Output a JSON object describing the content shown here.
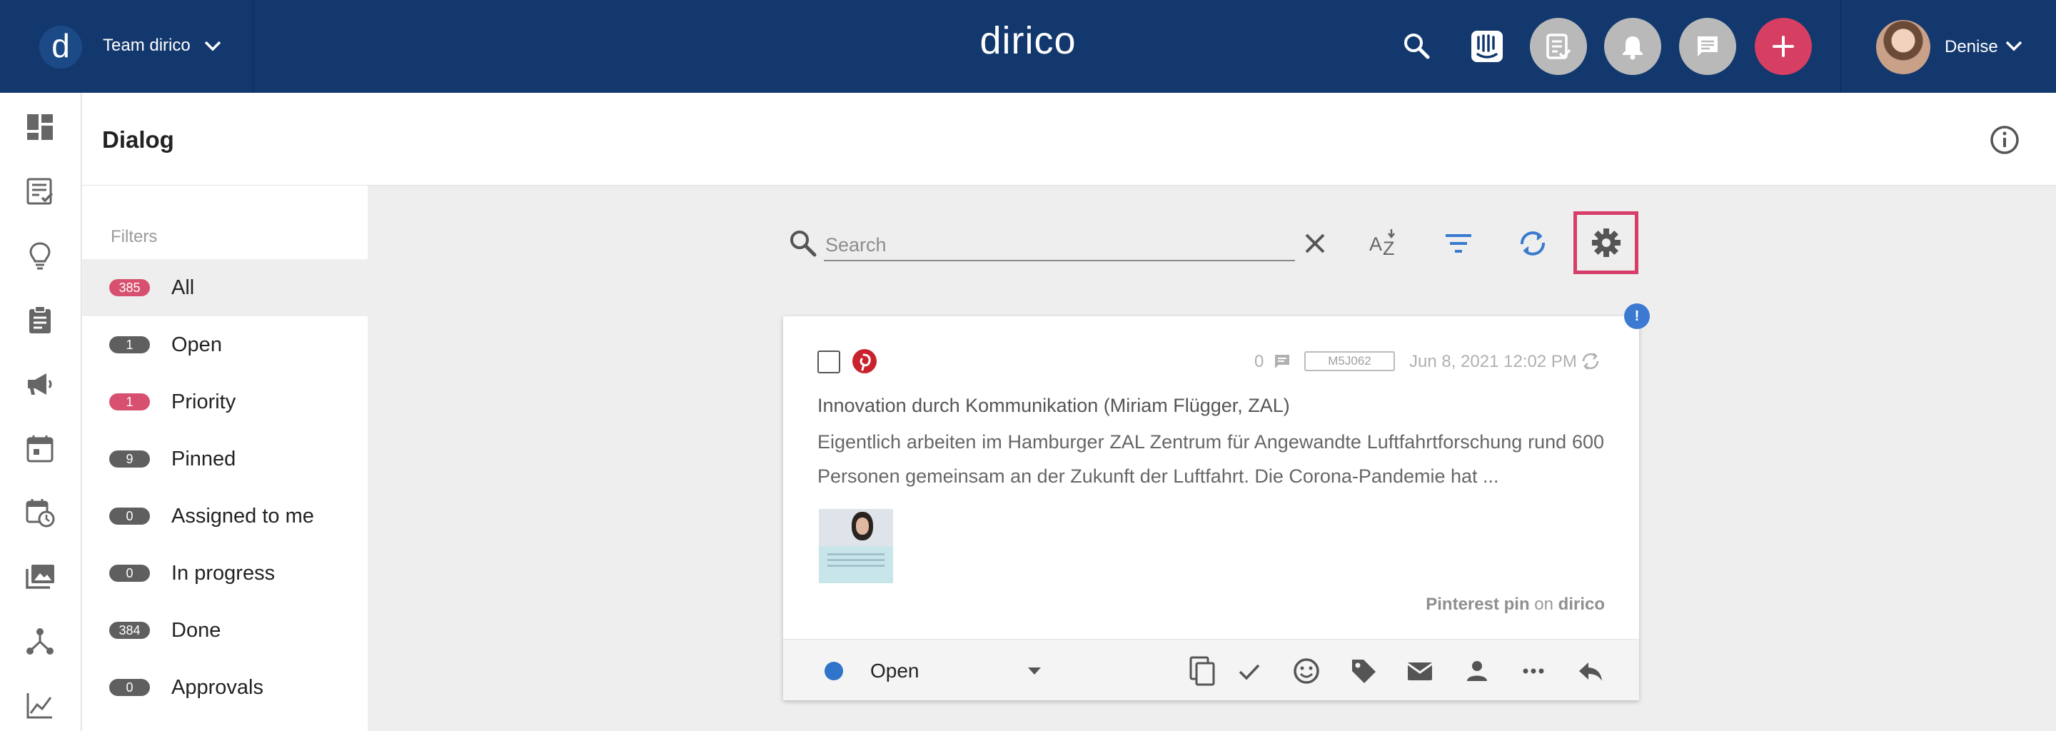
{
  "header": {
    "team_name": "Team dirico",
    "team_initial": "d",
    "brand": "dirico",
    "user_name": "Denise"
  },
  "rail": {
    "items": [
      "dashboard-icon",
      "tasks-icon",
      "ideas-icon",
      "clipboard-icon",
      "campaign-icon",
      "calendar-icon",
      "schedule-icon",
      "media-icon",
      "hierarchy-icon",
      "analytics-icon"
    ]
  },
  "page": {
    "title": "Dialog"
  },
  "filters": {
    "label": "Filters",
    "items": [
      {
        "count": "385",
        "label": "All",
        "highlight": true,
        "active": true
      },
      {
        "count": "1",
        "label": "Open",
        "highlight": false,
        "active": false
      },
      {
        "count": "1",
        "label": "Priority",
        "highlight": true,
        "active": false
      },
      {
        "count": "9",
        "label": "Pinned",
        "highlight": false,
        "active": false
      },
      {
        "count": "0",
        "label": "Assigned to me",
        "highlight": false,
        "active": false
      },
      {
        "count": "0",
        "label": "In progress",
        "highlight": false,
        "active": false
      },
      {
        "count": "384",
        "label": "Done",
        "highlight": false,
        "active": false
      },
      {
        "count": "0",
        "label": "Approvals",
        "highlight": false,
        "active": false
      }
    ]
  },
  "toolbar": {
    "search_placeholder": "Search",
    "search_value": ""
  },
  "card": {
    "flag": "!",
    "comment_count": "0",
    "id": "M5J062",
    "date": "Jun 8, 2021 12:02 PM",
    "title": "Innovation durch Kommunikation (Miriam Flügger, ZAL)",
    "body": "Eigentlich arbeiten im Hamburger ZAL Zentrum für Angewandte Luftfahrtforschung rund 600 Personen gemeinsam an der Zukunft der Luftfahrt. Die Corona-Pandemie hat ...",
    "source_type": "Pinterest pin",
    "source_on": "on",
    "source_account": "dirico",
    "status": "Open"
  },
  "colors": {
    "topbar": "#12386e",
    "accent": "#d63e62",
    "status_open": "#2f74c9",
    "highlight_box": "#d63e6a"
  }
}
